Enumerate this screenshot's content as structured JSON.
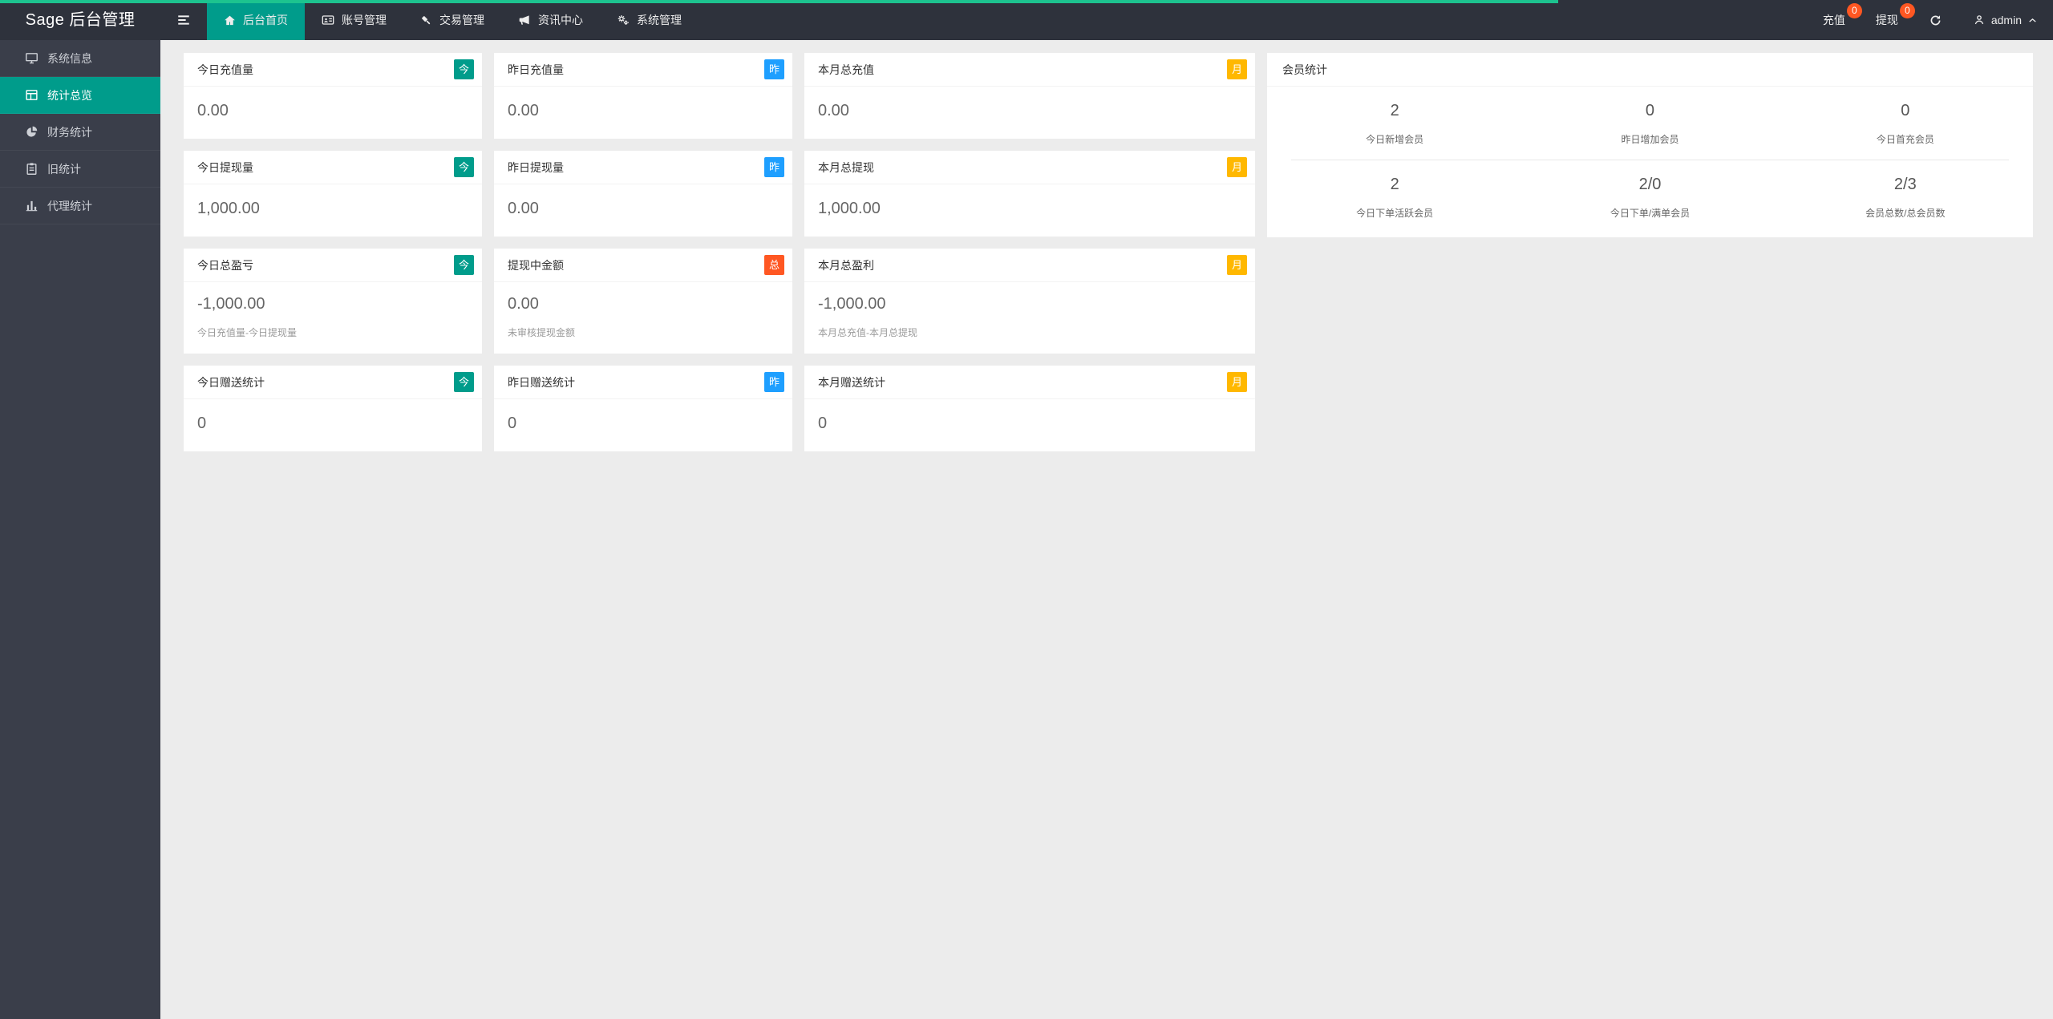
{
  "theme": {
    "progress_bar": "#1DC38F",
    "accent": "#009C8B",
    "badge_teal": "#009C8B",
    "badge_blue": "#1E9FFF",
    "badge_yellow": "#FFB800",
    "badge_orange": "#FF5722",
    "header_bg": "#2E323C",
    "sidebar_bg": "#3A3E4A",
    "content_bg": "#ECECEC"
  },
  "header": {
    "logo": "Sage 后台管理",
    "nav": [
      {
        "label": "后台首页",
        "icon": "home-icon",
        "active": true
      },
      {
        "label": "账号管理",
        "icon": "id-card-icon",
        "active": false
      },
      {
        "label": "交易管理",
        "icon": "gavel-icon",
        "active": false
      },
      {
        "label": "资讯中心",
        "icon": "bullhorn-icon",
        "active": false
      },
      {
        "label": "系统管理",
        "icon": "gears-icon",
        "active": false
      }
    ],
    "actions": [
      {
        "label": "充值",
        "badge": "0"
      },
      {
        "label": "提现",
        "badge": "0"
      }
    ],
    "user": {
      "name": "admin"
    }
  },
  "sidebar": {
    "items": [
      {
        "label": "系统信息",
        "icon": "monitor-icon",
        "active": false
      },
      {
        "label": "统计总览",
        "icon": "layout-grid-icon",
        "active": true
      },
      {
        "label": "财务统计",
        "icon": "pie-chart-icon",
        "active": false
      },
      {
        "label": "旧统计",
        "icon": "clipboard-icon",
        "active": false
      },
      {
        "label": "代理统计",
        "icon": "bar-chart-icon",
        "active": false
      }
    ]
  },
  "cards": [
    {
      "title": "今日充值量",
      "badge": "今",
      "badge_color": "#009C8B",
      "value": "0.00"
    },
    {
      "title": "昨日充值量",
      "badge": "昨",
      "badge_color": "#1E9FFF",
      "value": "0.00"
    },
    {
      "title": "本月总充值",
      "badge": "月",
      "badge_color": "#FFB800",
      "value": "0.00"
    },
    {
      "title": "今日提现量",
      "badge": "今",
      "badge_color": "#009C8B",
      "value": "1,000.00"
    },
    {
      "title": "昨日提现量",
      "badge": "昨",
      "badge_color": "#1E9FFF",
      "value": "0.00"
    },
    {
      "title": "本月总提现",
      "badge": "月",
      "badge_color": "#FFB800",
      "value": "1,000.00"
    },
    {
      "title": "今日总盈亏",
      "badge": "今",
      "badge_color": "#009C8B",
      "value": "-1,000.00",
      "note": "今日充值量-今日提现量"
    },
    {
      "title": "提现中金额",
      "badge": "总",
      "badge_color": "#FF5722",
      "value": "0.00",
      "note": "未审核提现金额"
    },
    {
      "title": "本月总盈利",
      "badge": "月",
      "badge_color": "#FFB800",
      "value": "-1,000.00",
      "note": "本月总充值-本月总提现"
    },
    {
      "title": "今日赠送统计",
      "badge": "今",
      "badge_color": "#009C8B",
      "value": "0"
    },
    {
      "title": "昨日赠送统计",
      "badge": "昨",
      "badge_color": "#1E9FFF",
      "value": "0"
    },
    {
      "title": "本月赠送统计",
      "badge": "月",
      "badge_color": "#FFB800",
      "value": "0"
    }
  ],
  "member_stats": {
    "title": "会员统计",
    "rows": [
      [
        {
          "value": "2",
          "label": "今日新增会员"
        },
        {
          "value": "0",
          "label": "昨日增加会员"
        },
        {
          "value": "0",
          "label": "今日首充会员"
        }
      ],
      [
        {
          "value": "2",
          "label": "今日下单活跃会员"
        },
        {
          "value": "2/0",
          "label": "今日下单/满单会员"
        },
        {
          "value": "2/3",
          "label": "会员总数/总会员数"
        }
      ]
    ]
  }
}
